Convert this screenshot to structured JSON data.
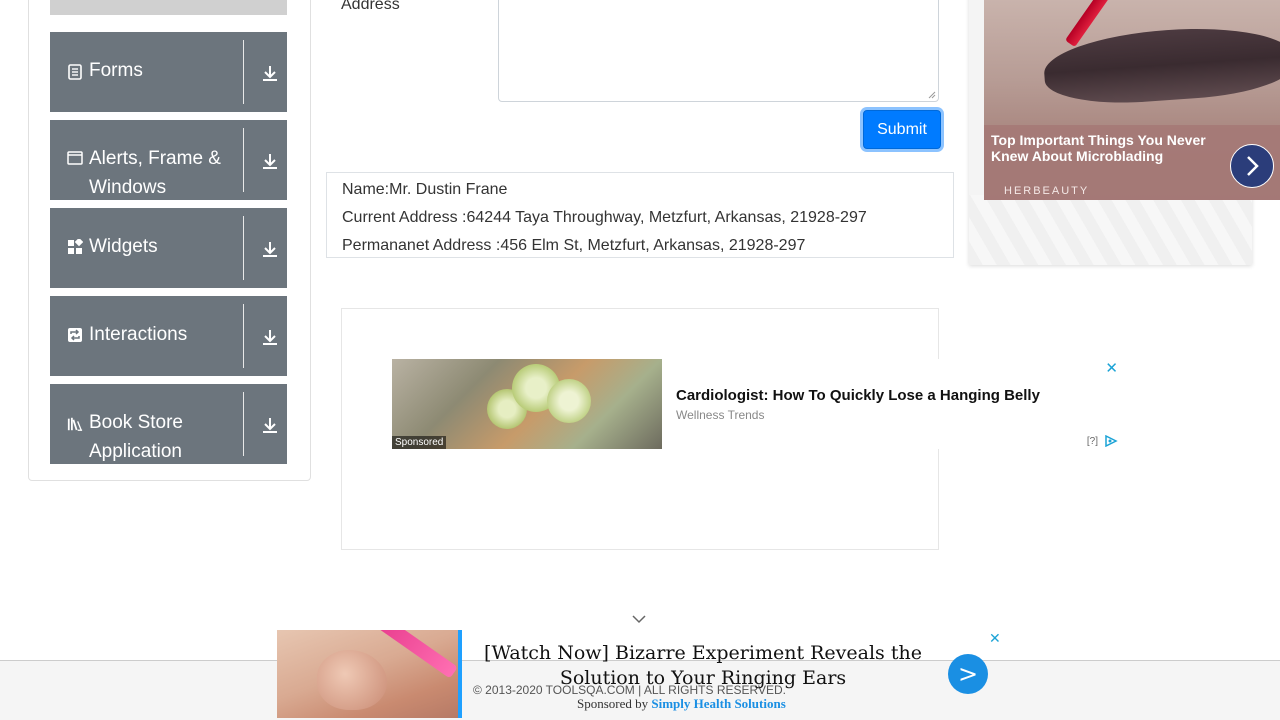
{
  "sidebar": {
    "groups": [
      {
        "label": "Forms",
        "icon": "form-icon"
      },
      {
        "label": "Alerts, Frame & Windows",
        "icon": "window-icon"
      },
      {
        "label": "Widgets",
        "icon": "widgets-icon"
      },
      {
        "label": "Interactions",
        "icon": "interactions-icon"
      },
      {
        "label": "Book Store Application",
        "icon": "books-icon"
      }
    ]
  },
  "form": {
    "address_label": "Address",
    "submit_label": "Submit"
  },
  "output": {
    "name": "Name:Mr. Dustin Frane",
    "current_address": "Current Address :64244 Taya Throughway, Metzfurt, Arkansas, 21928-297",
    "permanent_address": "Permananet Address :456 Elm St, Metzfurt, Arkansas, 21928-297"
  },
  "middle_ad": {
    "title": "Cardiologist: How To Quickly Lose a Hanging Belly",
    "source": "Wellness Trends",
    "sponsored": "Sponsored",
    "help": "[?]",
    "close": "✕"
  },
  "right_ad": {
    "text": "Top Important Things You Never Knew About Microblading",
    "brand": "HERBEAUTY"
  },
  "bottom_ad": {
    "title": "[Watch Now] Bizarre Experiment Reveals the Solution to Your Ringing Ears",
    "sponsored_prefix": "Sponsored by ",
    "sponsor": "Simply Health Solutions",
    "go": ">",
    "close": "✕"
  },
  "footer": {
    "text": "© 2013-2020 TOOLSQA.COM | ALL RIGHTS RESERVED."
  },
  "colors": {
    "sidebar_group_bg": "#6c757d",
    "primary": "#007bff",
    "ad_accent": "#1a8fe3"
  }
}
